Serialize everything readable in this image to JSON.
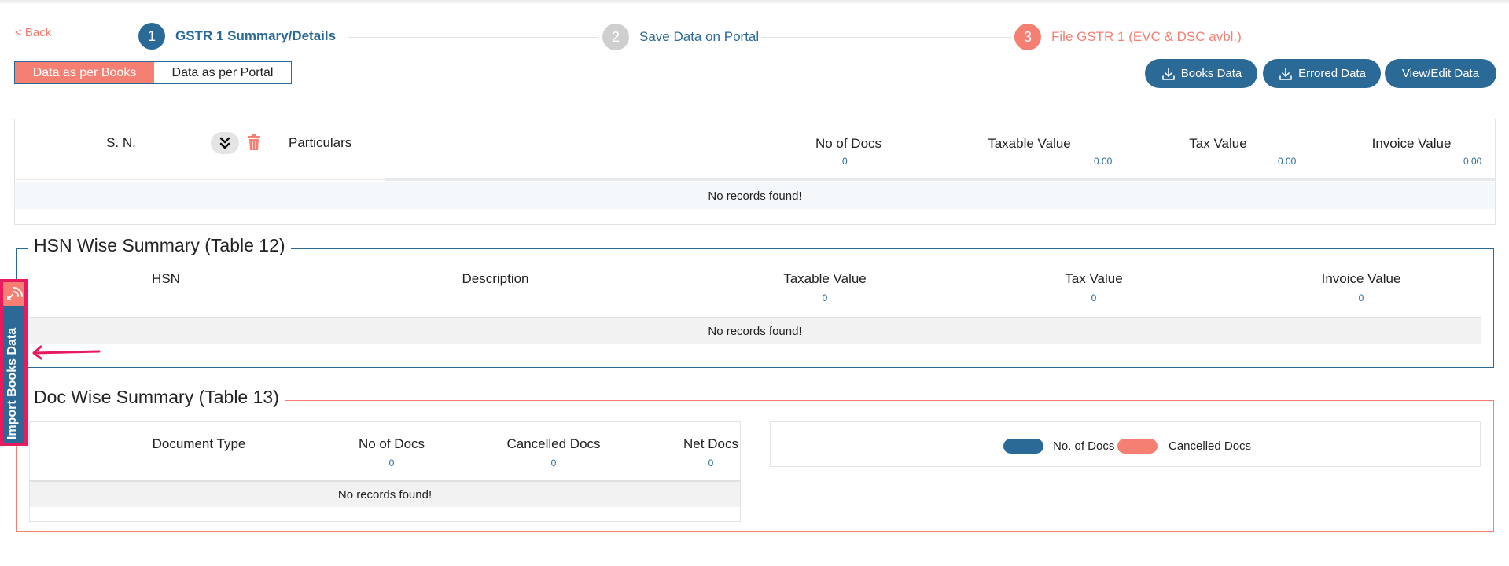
{
  "back_label": "< Back",
  "stepper": [
    {
      "num": "1",
      "label": "GSTR 1 Summary/Details"
    },
    {
      "num": "2",
      "label": "Save Data on Portal"
    },
    {
      "num": "3",
      "label": "File GSTR 1 (EVC & DSC avbl.)"
    }
  ],
  "toggle": {
    "books": "Data as per Books",
    "portal": "Data as per Portal",
    "active": "books"
  },
  "actions": {
    "books_data": "Books Data",
    "errored_data": "Errored Data",
    "view_edit": "View/Edit Data"
  },
  "main_table": {
    "headers": {
      "sn": "S. N.",
      "particulars": "Particulars",
      "no_of_docs": "No of Docs",
      "taxable_value": "Taxable Value",
      "tax_value": "Tax Value",
      "invoice_value": "Invoice Value"
    },
    "totals": {
      "no_of_docs": "0",
      "taxable_value": "0.00",
      "tax_value": "0.00",
      "invoice_value": "0.00"
    },
    "empty": "No records found!"
  },
  "hsn": {
    "title": "HSN Wise Summary (Table 12)",
    "headers": {
      "hsn": "HSN",
      "description": "Description",
      "taxable_value": "Taxable Value",
      "tax_value": "Tax Value",
      "invoice_value": "Invoice Value"
    },
    "totals": {
      "taxable_value": "0",
      "tax_value": "0",
      "invoice_value": "0"
    },
    "empty": "No records found!"
  },
  "doc": {
    "title": "Doc Wise Summary (Table 13)",
    "headers": {
      "document_type": "Document Type",
      "no_of_docs": "No of Docs",
      "cancelled_docs": "Cancelled Docs",
      "net_docs": "Net Docs"
    },
    "totals": {
      "no_of_docs": "0",
      "cancelled_docs": "0",
      "net_docs": "0"
    },
    "empty": "No records found!",
    "legend": {
      "no_of_docs": "No. of Docs",
      "cancelled_docs": "Cancelled Docs"
    }
  },
  "import_tab": "Import Books Data",
  "colors": {
    "primary": "#2b6a96",
    "accent": "#f57f72",
    "highlight": "#ea1a5c"
  }
}
